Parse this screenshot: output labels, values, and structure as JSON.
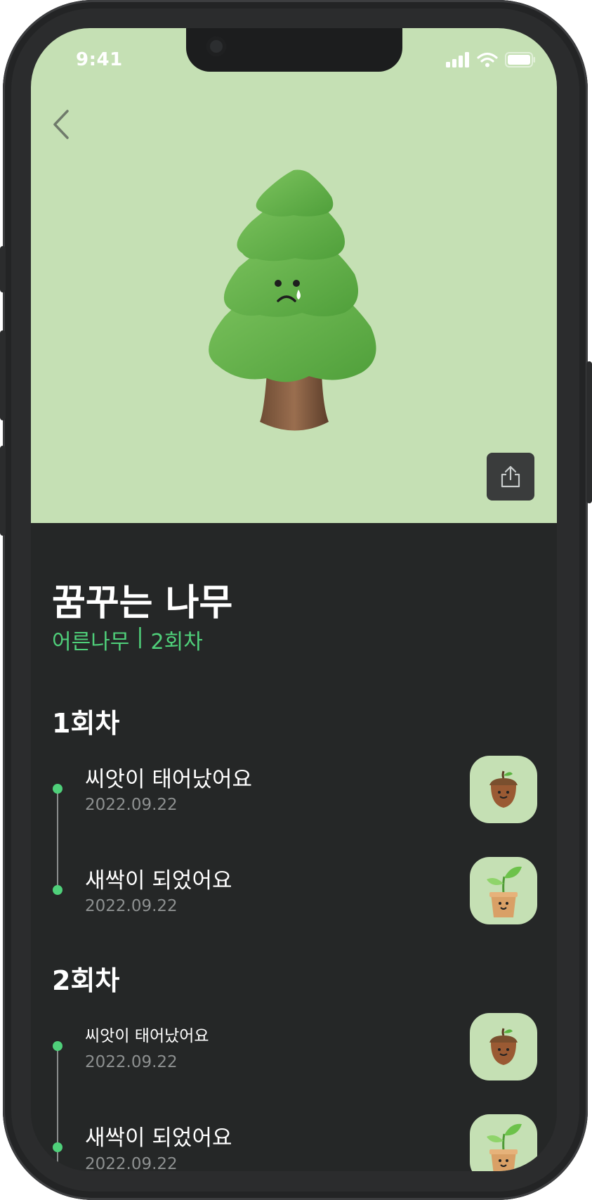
{
  "status_bar": {
    "time": "9:41"
  },
  "tree": {
    "name": "꿈꾸는 나무",
    "stage": "어른나무",
    "separator": "|",
    "round_count": "2회차"
  },
  "colors": {
    "hero_bg": "#c5e0b4",
    "accent": "#4fd07a",
    "screen_bg": "#252727",
    "date_text": "#8d9090"
  },
  "rounds": [
    {
      "label": "1회차",
      "events": [
        {
          "title": "씨앗이 태어났어요",
          "date": "2022.09.22",
          "icon": "acorn-icon"
        },
        {
          "title": "새싹이 되었어요",
          "date": "2022.09.22",
          "icon": "sprout-pot-icon"
        }
      ]
    },
    {
      "label": "2회차",
      "events": [
        {
          "title": "씨앗이 태어났어요",
          "date": "2022.09.22",
          "icon": "acorn-icon"
        },
        {
          "title": "새싹이 되었어요",
          "date": "2022.09.22",
          "icon": "sprout-pot-icon"
        }
      ]
    }
  ],
  "icons": {
    "back": "chevron-left-icon",
    "share": "share-icon",
    "hero": "sad-tree-illustration"
  }
}
